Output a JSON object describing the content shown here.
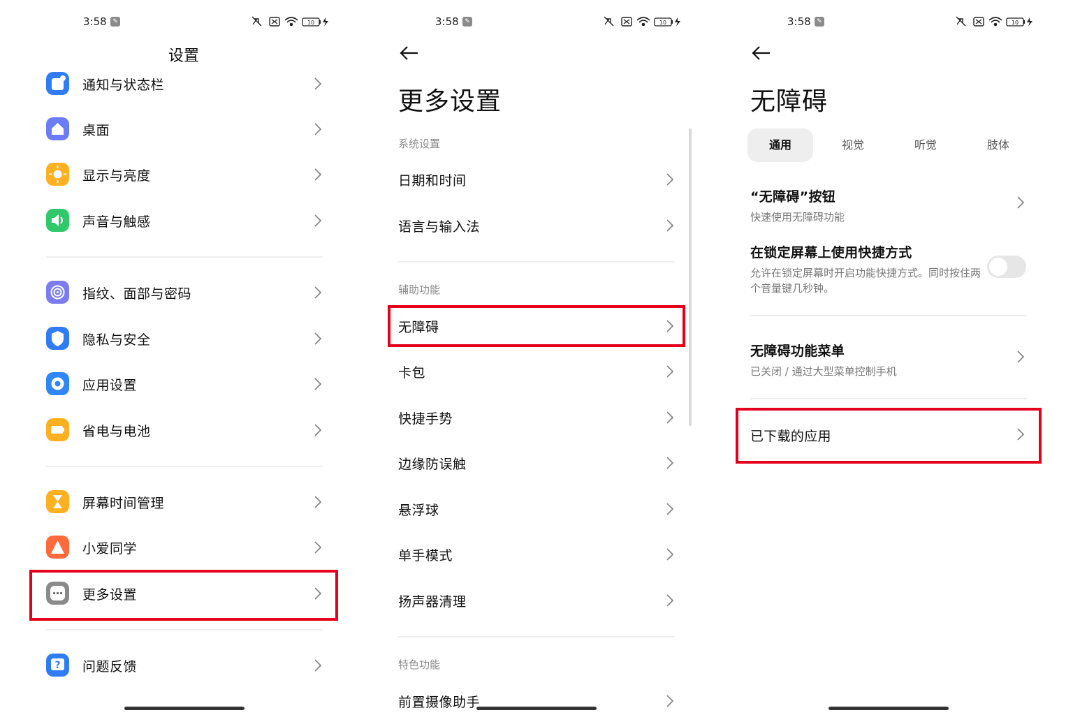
{
  "status": {
    "time": "3:58",
    "battery": "10"
  },
  "screen1": {
    "title": "设置",
    "items": [
      {
        "label": "通知与状态栏",
        "icon": "notification-icon",
        "color": "#2f7cf6"
      },
      {
        "label": "桌面",
        "icon": "home-icon",
        "color": "#6a7cf6"
      },
      {
        "label": "显示与亮度",
        "icon": "sun-icon",
        "color": "#ffb020"
      },
      {
        "label": "声音与触感",
        "icon": "speaker-icon",
        "color": "#2fc86a"
      },
      {
        "label": "指纹、面部与密码",
        "icon": "fingerprint-icon",
        "color": "#7b7cf0"
      },
      {
        "label": "隐私与安全",
        "icon": "shield-icon",
        "color": "#2f7cf6"
      },
      {
        "label": "应用设置",
        "icon": "gear-icon",
        "color": "#2f86f6"
      },
      {
        "label": "省电与电池",
        "icon": "battery-icon",
        "color": "#ffb020"
      },
      {
        "label": "屏幕时间管理",
        "icon": "hourglass-icon",
        "color": "#ffb020"
      },
      {
        "label": "小爱同学",
        "icon": "xiaoai-icon",
        "color": "#ff6a3d"
      },
      {
        "label": "更多设置",
        "icon": "more-icon",
        "color": "#8a8a8a"
      },
      {
        "label": "问题反馈",
        "icon": "question-icon",
        "color": "#2f7cf6"
      }
    ]
  },
  "screen2": {
    "title": "更多设置",
    "sections": [
      {
        "header": "系统设置",
        "items": [
          "日期和时间",
          "语言与输入法"
        ]
      },
      {
        "header": "辅助功能",
        "items": [
          "无障碍",
          "卡包",
          "快捷手势",
          "边缘防误触",
          "悬浮球",
          "单手模式",
          "扬声器清理"
        ]
      },
      {
        "header": "特色功能",
        "items": [
          "前置摄像助手"
        ]
      }
    ]
  },
  "screen3": {
    "title": "无障碍",
    "tabs": [
      "通用",
      "视觉",
      "听觉",
      "肢体"
    ],
    "active_tab": "通用",
    "items": [
      {
        "title": "“无障碍”按钮",
        "subtitle": "快速使用无障碍功能"
      },
      {
        "title": "在锁定屏幕上使用快捷方式",
        "subtitle": "允许在锁定屏幕时开启功能快捷方式。同时按住两个音量键几秒钟。",
        "toggle": false
      },
      {
        "title": "无障碍功能菜单",
        "subtitle": "已关闭 / 通过大型菜单控制手机"
      },
      {
        "title": "已下载的应用",
        "subtitle": ""
      }
    ]
  },
  "highlight_color": "#e4001c"
}
